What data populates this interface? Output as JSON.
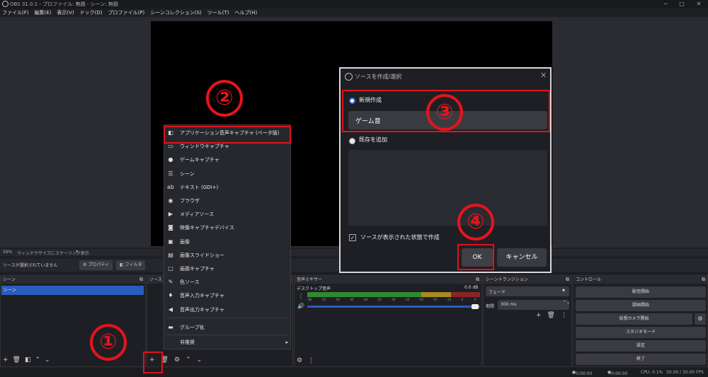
{
  "titlebar": {
    "title": "OBS 31.0.1 - プロファイル: 無題 - シーン: 無題",
    "minimize": "─",
    "maximize": "□",
    "close": "✕"
  },
  "menubar": [
    "ファイル(F)",
    "編集(E)",
    "表示(V)",
    "ドック(D)",
    "プロファイル(P)",
    "シーンコレクション(S)",
    "ツール(T)",
    "ヘルプ(H)"
  ],
  "scalebar": {
    "zoom": "56%",
    "scaling": "ウィンドウサイズにスケーリング表示"
  },
  "source_toolbar": {
    "no_selection": "ソースが選択されていません",
    "properties": "プロパティ",
    "filters": "フィルタ"
  },
  "scenes": {
    "header": "シーン",
    "items": [
      "シーン"
    ]
  },
  "sources": {
    "header": "ソース"
  },
  "mixer": {
    "header": "音声ミキサー",
    "track": "デスクトップ音声",
    "db": "0.0 dB",
    "ticks": [
      "-60",
      "-55",
      "-50",
      "-45",
      "-40",
      "-35",
      "-30",
      "-25",
      "-20",
      "-15",
      "-10",
      "-5",
      "0"
    ],
    "volume": 1.0
  },
  "transitions": {
    "header": "シーントランジション",
    "selected": "フェード",
    "duration_label": "期間",
    "duration": "300 ms"
  },
  "controls": {
    "header": "コントロール",
    "buttons": [
      "配信開始",
      "録画開始",
      "仮想カメラ開始",
      "スタジオモード",
      "設定",
      "終了"
    ]
  },
  "add_menu": {
    "items": [
      {
        "icon": "app-audio-icon",
        "glyph": "◧",
        "label": "アプリケーション音声キャプチャ (ベータ版)"
      },
      {
        "icon": "window-capture-icon",
        "glyph": "▭",
        "label": "ウィンドウキャプチャ"
      },
      {
        "icon": "gamepad-icon",
        "glyph": "●",
        "label": "ゲームキャプチャ"
      },
      {
        "icon": "list-icon",
        "glyph": "☰",
        "label": "シーン"
      },
      {
        "icon": "text-icon",
        "glyph": "ab",
        "label": "テキスト (GDI+)"
      },
      {
        "icon": "globe-icon",
        "glyph": "◉",
        "label": "ブラウザ"
      },
      {
        "icon": "play-icon",
        "glyph": "▶",
        "label": "メディアソース"
      },
      {
        "icon": "camera-icon",
        "glyph": "◙",
        "label": "映像キャプチャデバイス"
      },
      {
        "icon": "image-icon",
        "glyph": "▣",
        "label": "画像"
      },
      {
        "icon": "slideshow-icon",
        "glyph": "▤",
        "label": "画像スライドショー"
      },
      {
        "icon": "monitor-icon",
        "glyph": "▢",
        "label": "画面キャプチャ"
      },
      {
        "icon": "brush-icon",
        "glyph": "✎",
        "label": "色ソース"
      },
      {
        "icon": "mic-icon",
        "glyph": "♦",
        "label": "音声入力キャプチャ"
      },
      {
        "icon": "speaker-icon",
        "glyph": "◀",
        "label": "音声出力キャプチャ"
      }
    ],
    "group": {
      "icon": "folder-icon",
      "glyph": "▬",
      "label": "グループ化"
    },
    "deprecated": "非推奨"
  },
  "dialog": {
    "title": "ソースを作成/選択",
    "create_new": "新規作成",
    "name_value": "ゲーム音",
    "add_existing": "既存を追加",
    "visible_checkbox": "ソースが表示された状態で作成",
    "ok": "OK",
    "cancel": "キャンセル"
  },
  "annotations": {
    "n1": "①",
    "n2": "②",
    "n3": "③",
    "n4": "④"
  },
  "statusbar": {
    "net": "0:00:00",
    "rec": "0:00:00",
    "cpu": "CPU: 0.1%",
    "fps": "30.00 / 30.00 FPS"
  },
  "colors": {
    "accent": "#2a5cbf",
    "annotation": "#e0121b",
    "meter_green": "#2f8b2f",
    "meter_yellow": "#a88a23",
    "meter_red": "#8b2525"
  }
}
